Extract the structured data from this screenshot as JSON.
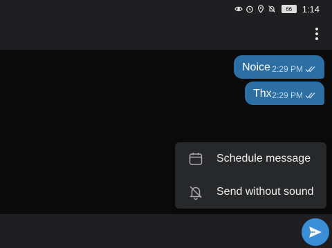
{
  "status_bar": {
    "icons": [
      "eye-icon",
      "alarm-icon",
      "location-icon",
      "bell-off-icon"
    ],
    "battery": "66",
    "time": "1:14"
  },
  "header": {
    "menu_icon": "more-vertical-icon"
  },
  "messages": [
    {
      "text": "Noice",
      "time": "2:29 PM",
      "status_icon": "double-check-icon"
    },
    {
      "text": "Thx",
      "time": "2:29 PM",
      "status_icon": "double-check-icon"
    }
  ],
  "send_menu": {
    "items": [
      {
        "label": "Schedule message",
        "icon": "calendar-icon"
      },
      {
        "label": "Send without sound",
        "icon": "bell-off-icon"
      }
    ]
  },
  "composer": {
    "send_icon": "send-icon"
  },
  "colors": {
    "bubble": "#2d6fa3",
    "send_button": "#3b8fd6",
    "bars": "#1f1f21",
    "background": "#0b0b0c",
    "popup": "#27282a"
  }
}
